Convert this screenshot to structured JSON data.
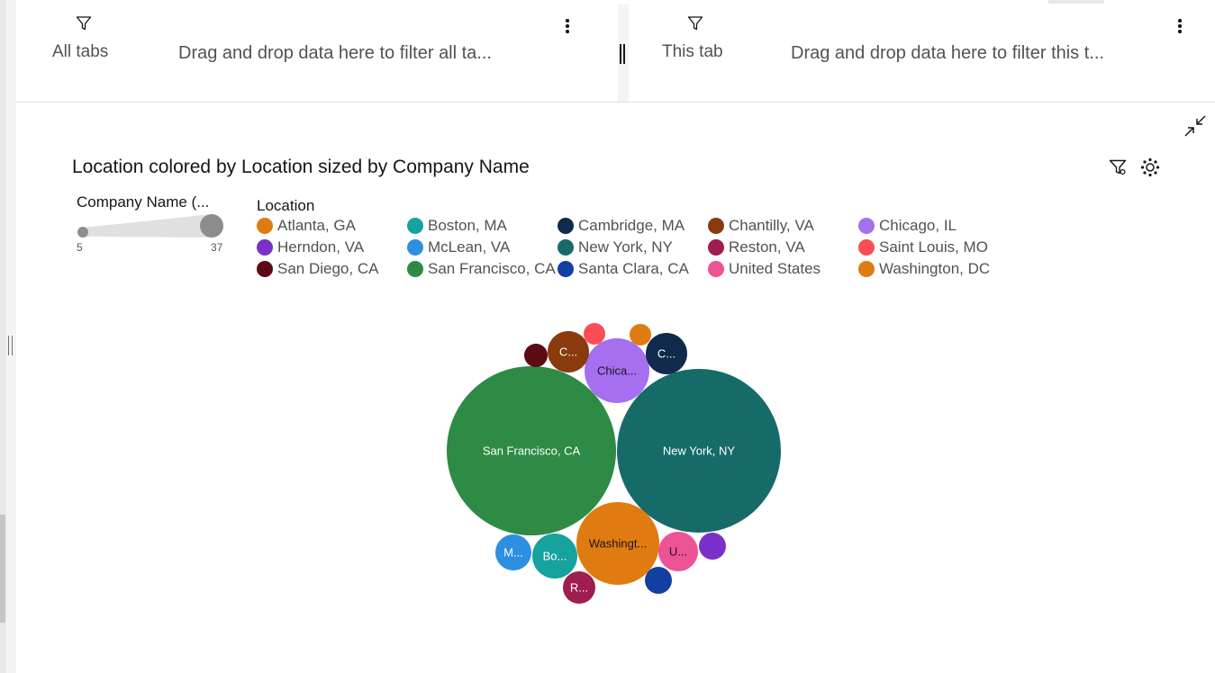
{
  "filters": {
    "all_tabs": {
      "label": "All tabs",
      "drop_text": "Drag and drop data here to filter all ta..."
    },
    "this_tab": {
      "label": "This tab",
      "drop_text": "Drag and drop data here to filter this t..."
    }
  },
  "icons": {
    "filter": "filter-funnel-icon",
    "overflow": "overflow-menu-vertical-icon",
    "minimize": "minimize-arrows-icon",
    "chart_filter": "filter-funnel-icon",
    "chart_settings": "settings-adjust-icon"
  },
  "chart": {
    "title": "Location colored by Location sized by Company Name",
    "size_legend": {
      "title": "Company Name (...",
      "min": "5",
      "max": "37"
    },
    "color_legend": {
      "title": "Location",
      "items": [
        {
          "label": "Atlanta, GA",
          "color": "#e07b12"
        },
        {
          "label": "Boston, MA",
          "color": "#16a39f"
        },
        {
          "label": "Cambridge, MA",
          "color": "#102a4c"
        },
        {
          "label": "Chantilly, VA",
          "color": "#8a3b0e"
        },
        {
          "label": "Chicago, IL",
          "color": "#a66ff0"
        },
        {
          "label": "Herndon, VA",
          "color": "#7b30c9"
        },
        {
          "label": "McLean, VA",
          "color": "#2d8fe0"
        },
        {
          "label": "New York, NY",
          "color": "#166b69"
        },
        {
          "label": "Reston, VA",
          "color": "#9f1d4f"
        },
        {
          "label": "Saint Louis, MO",
          "color": "#fa4d56"
        },
        {
          "label": "San Diego, CA",
          "color": "#5a0b14"
        },
        {
          "label": "San Francisco, CA",
          "color": "#2e8b45"
        },
        {
          "label": "Santa Clara, CA",
          "color": "#1140a0"
        },
        {
          "label": "United States",
          "color": "#ee5396"
        },
        {
          "label": "Washington, DC",
          "color": "#e07b12"
        }
      ]
    }
  },
  "chart_data": {
    "type": "bubble",
    "title": "Location colored by Location sized by Company Name",
    "size_field": "Company Name (...",
    "color_field": "Location",
    "size_range": [
      5,
      37
    ],
    "bubbles": [
      {
        "location": "San Francisco, CA",
        "label": "San Francisco, CA",
        "value": 37,
        "color": "#2e8b45",
        "text_color": "#ffffff"
      },
      {
        "location": "New York, NY",
        "label": "New York, NY",
        "value": 36,
        "color": "#166b69",
        "text_color": "#ffffff"
      },
      {
        "location": "Washington, DC",
        "label": "Washingt...",
        "value": 16,
        "color": "#e07b12",
        "text_color": "#161616"
      },
      {
        "location": "Chicago, IL",
        "label": "Chica...",
        "value": 12,
        "color": "#a66ff0",
        "text_color": "#161616"
      },
      {
        "location": "Chantilly, VA",
        "label": "C...",
        "value": 6,
        "color": "#8a3b0e",
        "text_color": "#ffffff"
      },
      {
        "location": "Cambridge, MA",
        "label": "C...",
        "value": 6,
        "color": "#102a4c",
        "text_color": "#ffffff"
      },
      {
        "location": "Boston, MA",
        "label": "Bo...",
        "value": 7,
        "color": "#16a39f",
        "text_color": "#ffffff"
      },
      {
        "location": "United States",
        "label": "U...",
        "value": 6,
        "color": "#ee5396",
        "text_color": "#161616"
      },
      {
        "location": "McLean, VA",
        "label": "M...",
        "value": 5,
        "color": "#2d8fe0",
        "text_color": "#ffffff"
      },
      {
        "location": "Reston, VA",
        "label": "R...",
        "value": 5,
        "color": "#9f1d4f",
        "text_color": "#ffffff"
      },
      {
        "location": "Santa Clara, CA",
        "label": "",
        "value": 5,
        "color": "#1140a0",
        "text_color": "#ffffff"
      },
      {
        "location": "Herndon, VA",
        "label": "",
        "value": 5,
        "color": "#7b30c9",
        "text_color": "#ffffff"
      },
      {
        "location": "San Diego, CA",
        "label": "",
        "value": 5,
        "color": "#5a0b14",
        "text_color": "#ffffff"
      },
      {
        "location": "Saint Louis, MO",
        "label": "",
        "value": 5,
        "color": "#fa4d56",
        "text_color": "#ffffff"
      },
      {
        "location": "Atlanta, GA",
        "label": "",
        "value": 5,
        "color": "#e07b12",
        "text_color": "#ffffff"
      }
    ]
  }
}
